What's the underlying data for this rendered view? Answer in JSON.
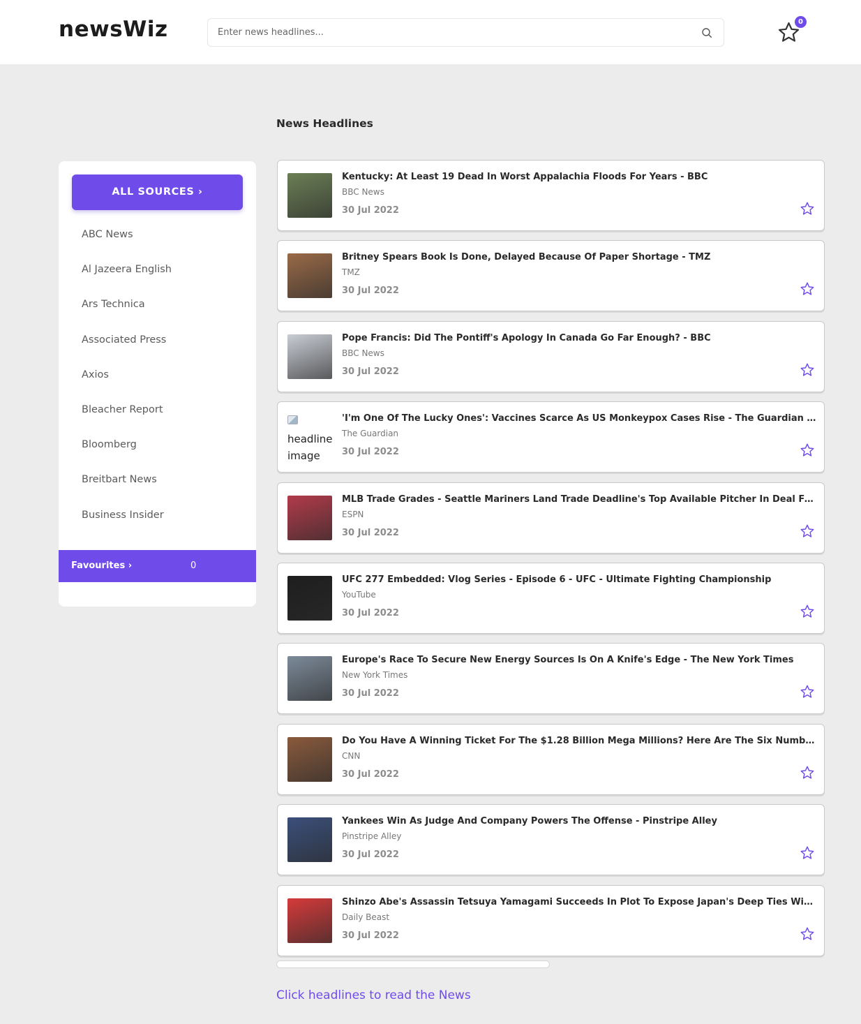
{
  "header": {
    "logo": "newsWiz",
    "search_placeholder": "Enter news headlines...",
    "favourites_count": "0"
  },
  "sidebar": {
    "all_sources_label": "ALL SOURCES ›",
    "sources": [
      "ABC News",
      "Al Jazeera English",
      "Ars Technica",
      "Associated Press",
      "Axios",
      "Bleacher Report",
      "Bloomberg",
      "Breitbart News",
      "Business Insider"
    ],
    "favourites_label": "Favourites ›",
    "favourites_count": "0"
  },
  "main": {
    "section_title": "News Headlines",
    "articles": [
      {
        "title": "Kentucky: At Least 19 Dead In Worst Appalachia Floods For Years - BBC",
        "source": "BBC News",
        "date": "30 Jul 2022",
        "thumb_color": "#6b7f55"
      },
      {
        "title": "Britney Spears Book Is Done, Delayed Because Of Paper Shortage - TMZ",
        "source": "TMZ",
        "date": "30 Jul 2022",
        "thumb_color": "#9a6a47"
      },
      {
        "title": "Pope Francis: Did The Pontiff's Apology In Canada Go Far Enough? - BBC",
        "source": "BBC News",
        "date": "30 Jul 2022",
        "thumb_color": "#c9cdd4"
      },
      {
        "title": "'I'm One Of The Lucky Ones': Vaccines Scarce As US Monkeypox Cases Rise - The Guardian US",
        "source": "The Guardian",
        "date": "30 Jul 2022",
        "thumb_alt": "headline image"
      },
      {
        "title": "MLB Trade Grades - Seattle Mariners Land Trade Deadline's Top Available Pitcher In Deal For Luis Castillo - ESPN",
        "source": "ESPN",
        "date": "30 Jul 2022",
        "thumb_color": "#b23b4a"
      },
      {
        "title": "UFC 277 Embedded: Vlog Series - Episode 6 - UFC - Ultimate Fighting Championship",
        "source": "YouTube",
        "date": "30 Jul 2022",
        "thumb_color": "#1e1e1e"
      },
      {
        "title": "Europe's Race To Secure New Energy Sources Is On A Knife's Edge - The New York Times",
        "source": "New York Times",
        "date": "30 Jul 2022",
        "thumb_color": "#7c8a99"
      },
      {
        "title": "Do You Have A Winning Ticket For The $1.28 Billion Mega Millions? Here Are The Six Numbers - CNN",
        "source": "CNN",
        "date": "30 Jul 2022",
        "thumb_color": "#8a5a3c"
      },
      {
        "title": "Yankees Win As Judge And Company Powers The Offense - Pinstripe Alley",
        "source": "Pinstripe Alley",
        "date": "30 Jul 2022",
        "thumb_color": "#3a4f7a"
      },
      {
        "title": "Shinzo Abe's Assassin Tetsuya Yamagami Succeeds In Plot To Expose Japan's Deep Ties With Unification Church",
        "source": "Daily Beast",
        "date": "30 Jul 2022",
        "thumb_color": "#d63a3a"
      }
    ]
  },
  "footer": {
    "hint": "Click headlines to read the News"
  },
  "colors": {
    "accent": "#6f4bea",
    "page_bg": "#ececec"
  }
}
